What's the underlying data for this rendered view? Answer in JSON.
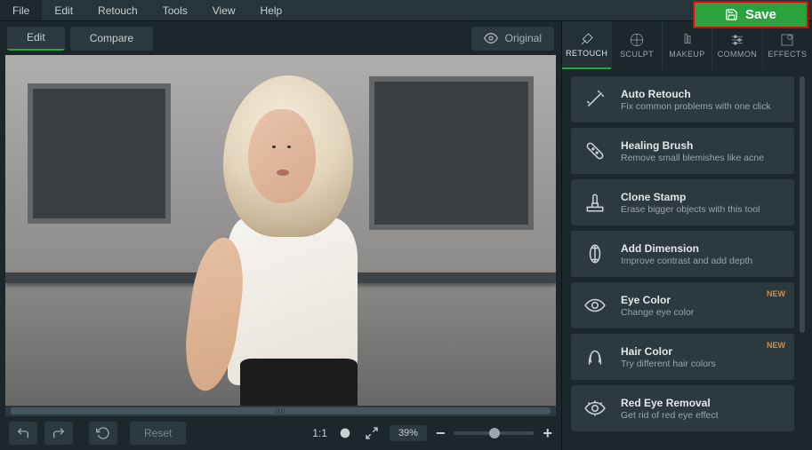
{
  "menu": {
    "items": [
      "File",
      "Edit",
      "Retouch",
      "Tools",
      "View",
      "Help"
    ],
    "save": "Save"
  },
  "toolbar": {
    "edit": "Edit",
    "compare": "Compare",
    "original": "Original"
  },
  "bottom": {
    "reset": "Reset",
    "fit": "1:1",
    "zoom": "39%"
  },
  "tabs": [
    "RETOUCH",
    "SCULPT",
    "MAKEUP",
    "COMMON",
    "EFFECTS"
  ],
  "tools": [
    {
      "name": "Auto Retouch",
      "desc": "Fix common problems with one click",
      "badge": ""
    },
    {
      "name": "Healing Brush",
      "desc": "Remove small blemishes like acne",
      "badge": ""
    },
    {
      "name": "Clone Stamp",
      "desc": "Erase bigger objects with this tool",
      "badge": ""
    },
    {
      "name": "Add Dimension",
      "desc": "Improve contrast and add depth",
      "badge": ""
    },
    {
      "name": "Eye Color",
      "desc": "Change eye color",
      "badge": "NEW"
    },
    {
      "name": "Hair Color",
      "desc": "Try different hair colors",
      "badge": "NEW"
    },
    {
      "name": "Red Eye Removal",
      "desc": "Get rid of red eye effect",
      "badge": ""
    }
  ]
}
